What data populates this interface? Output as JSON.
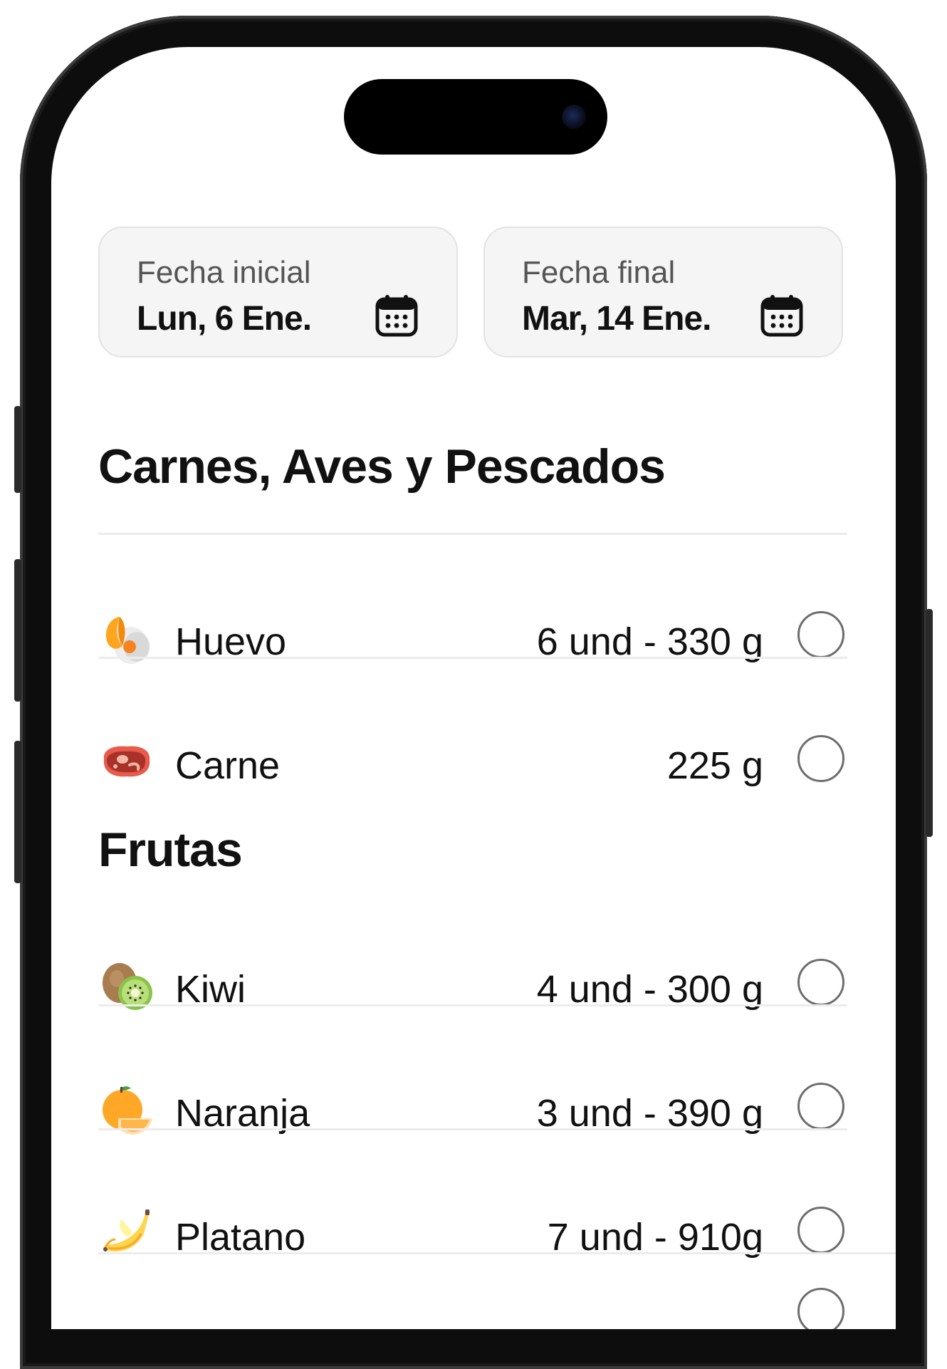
{
  "date_range": {
    "start": {
      "label": "Fecha inicial",
      "value": "Lun, 6 Ene.",
      "icon": "calendar-icon"
    },
    "end": {
      "label": "Fecha final",
      "value": "Mar, 14 Ene.",
      "icon": "calendar-icon"
    }
  },
  "sections": [
    {
      "title": "Carnes, Aves y Pescados",
      "items": [
        {
          "name": "Huevo",
          "quantity": "6 und - 330 g",
          "icon": "egg-icon",
          "checked": false
        },
        {
          "name": "Carne",
          "quantity": "225 g",
          "icon": "meat-icon",
          "checked": false
        }
      ]
    },
    {
      "title": "Frutas",
      "items": [
        {
          "name": "Kiwi",
          "quantity": "4 und - 300 g",
          "icon": "kiwi-icon",
          "checked": false
        },
        {
          "name": "Naranja",
          "quantity": "3 und - 390 g",
          "icon": "orange-icon",
          "checked": false
        },
        {
          "name": "Platano",
          "quantity": "7 und - 910g",
          "icon": "banana-icon",
          "checked": false
        }
      ]
    }
  ],
  "colors": {
    "card_background": "#f5f5f5",
    "card_border": "#e3e3e3",
    "divider": "#ececec",
    "check_border": "#6d6d6d"
  }
}
